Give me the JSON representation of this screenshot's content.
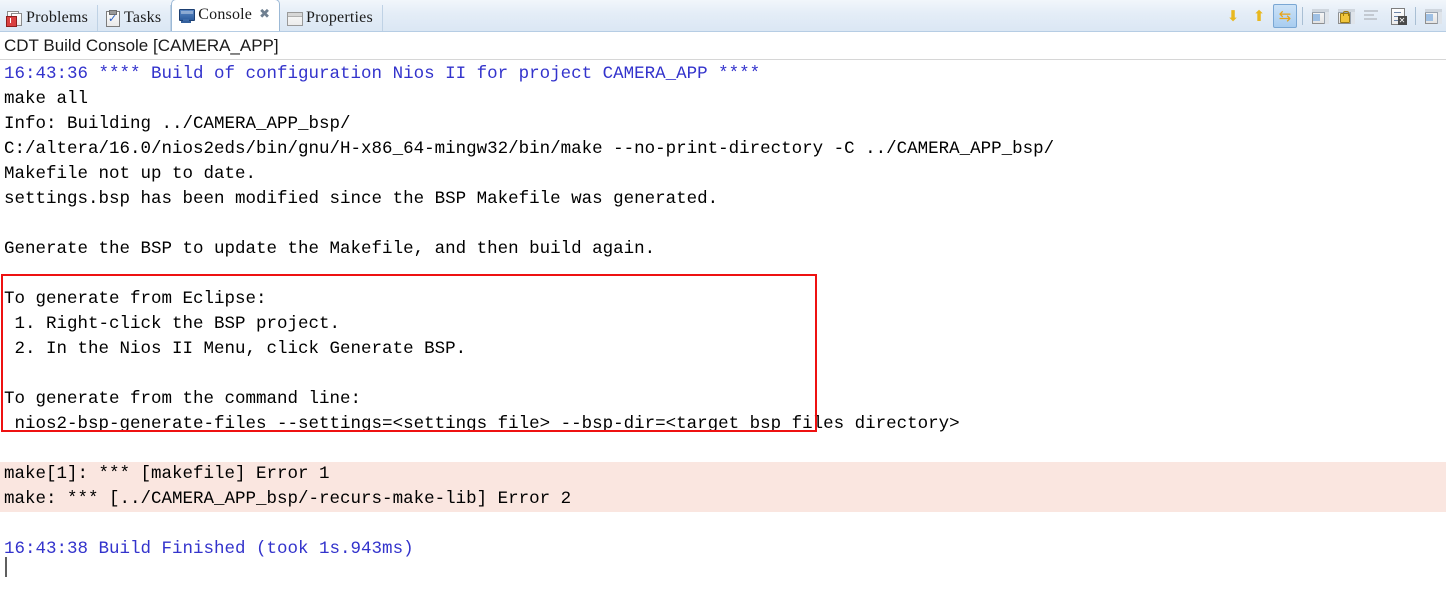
{
  "window": {
    "view_title": "CDT Build Console [CAMERA_APP]"
  },
  "tabs": [
    {
      "label": "Problems",
      "icon": "problems-icon",
      "active": false,
      "close": ""
    },
    {
      "label": "Tasks",
      "icon": "tasks-icon",
      "active": false,
      "close": ""
    },
    {
      "label": "Console",
      "icon": "console-icon",
      "active": true,
      "close": "✖"
    },
    {
      "label": "Properties",
      "icon": "properties-icon",
      "active": false,
      "close": ""
    }
  ],
  "toolbar": {
    "buttons": [
      {
        "name": "scroll-down-icon",
        "glyph": "⬇",
        "pressed": false,
        "color": "#e8b820"
      },
      {
        "name": "scroll-up-icon",
        "glyph": "⬆",
        "pressed": false,
        "color": "#e8b820"
      },
      {
        "name": "scroll-lock-icon",
        "glyph": "⇆",
        "pressed": true,
        "color": "#e8a317"
      },
      {
        "name": "display-console-icon",
        "glyph": "",
        "pressed": false,
        "color": ""
      },
      {
        "name": "pin-console-icon",
        "glyph": "",
        "pressed": false,
        "color": ""
      },
      {
        "name": "clear-console-icon",
        "glyph": "",
        "pressed": false,
        "color": ""
      },
      {
        "name": "remove-console-icon",
        "glyph": "",
        "pressed": false,
        "color": ""
      },
      {
        "name": "open-console-icon",
        "glyph": "",
        "pressed": false,
        "color": ""
      }
    ]
  },
  "colors": {
    "info_blue": "#3333CC",
    "error_bg": "#FAE6E0",
    "annotation_red": "#EE1111",
    "tab_active_bg": "#FFFFFF"
  },
  "console": {
    "lines": [
      {
        "text": "16:43:36 **** Build of configuration Nios II for project CAMERA_APP ****",
        "style": "blue"
      },
      {
        "text": "make all",
        "style": "plain"
      },
      {
        "text": "Info: Building ../CAMERA_APP_bsp/",
        "style": "plain"
      },
      {
        "text": "C:/altera/16.0/nios2eds/bin/gnu/H-x86_64-mingw32/bin/make --no-print-directory -C ../CAMERA_APP_bsp/",
        "style": "plain"
      },
      {
        "text": "Makefile not up to date.",
        "style": "plain"
      },
      {
        "text": "settings.bsp has been modified since the BSP Makefile was generated.",
        "style": "plain"
      },
      {
        "text": "",
        "style": "plain"
      },
      {
        "text": "Generate the BSP to update the Makefile, and then build again.",
        "style": "plain"
      },
      {
        "text": "",
        "style": "plain"
      },
      {
        "text": "To generate from Eclipse:",
        "style": "plain"
      },
      {
        "text": " 1. Right-click the BSP project.",
        "style": "plain"
      },
      {
        "text": " 2. In the Nios II Menu, click Generate BSP.",
        "style": "plain"
      },
      {
        "text": "",
        "style": "plain"
      },
      {
        "text": "To generate from the command line:",
        "style": "plain"
      },
      {
        "text": " nios2-bsp-generate-files --settings=<settings file> --bsp-dir=<target bsp files directory>",
        "style": "plain"
      },
      {
        "text": "",
        "style": "plain"
      },
      {
        "text": "make[1]: *** [makefile] Error 1",
        "style": "err"
      },
      {
        "text": "make: *** [../CAMERA_APP_bsp/-recurs-make-lib] Error 2",
        "style": "err"
      },
      {
        "text": "",
        "style": "plain"
      },
      {
        "text": "16:43:38 Build Finished (took 1s.943ms)",
        "style": "blue"
      },
      {
        "text": "",
        "style": "plain"
      }
    ]
  }
}
